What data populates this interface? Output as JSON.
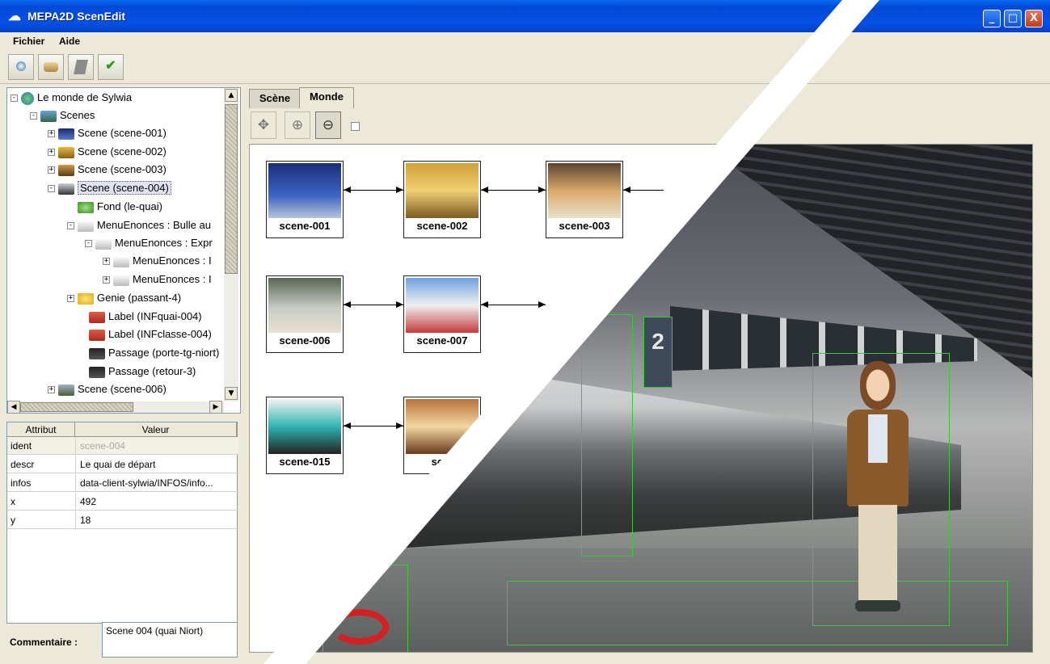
{
  "window": {
    "title": "MEPA2D ScenEdit",
    "minimize": "_",
    "maximize": "□",
    "close": "X"
  },
  "menu": {
    "fichier": "Fichier",
    "aide": "Aide"
  },
  "toolbar": {
    "icons": [
      "new-icon",
      "open-icon",
      "save-icon",
      "validate-icon"
    ]
  },
  "tree": {
    "root": "Le monde de Sylwia",
    "scenes": "Scenes",
    "items": [
      {
        "label": "Scene (scene-001)",
        "toggle": "+"
      },
      {
        "label": "Scene (scene-002)",
        "toggle": "+"
      },
      {
        "label": "Scene (scene-003)",
        "toggle": "+"
      },
      {
        "label": "Scene (scene-004)",
        "toggle": "-"
      },
      {
        "label": "Fond (le-quai)"
      },
      {
        "label": "MenuEnonces : Bulle au",
        "toggle": "-"
      },
      {
        "label": "MenuEnonces : Expr",
        "toggle": "-"
      },
      {
        "label": "MenuEnonces : I",
        "toggle": "+"
      },
      {
        "label": "MenuEnonces : I",
        "toggle": "+"
      },
      {
        "label": "Genie (passant-4)",
        "toggle": "+"
      },
      {
        "label": "Label (INFquai-004)"
      },
      {
        "label": "Label (INFclasse-004)"
      },
      {
        "label": "Passage (porte-tg-niort)"
      },
      {
        "label": "Passage (retour-3)"
      },
      {
        "label": "Scene (scene-006)",
        "toggle": "+"
      }
    ]
  },
  "properties": {
    "header_attr": "Attribut",
    "header_val": "Valeur",
    "rows": [
      {
        "attr": "ident",
        "val": "scene-004"
      },
      {
        "attr": "descr",
        "val": "Le quai de départ"
      },
      {
        "attr": "infos",
        "val": "data-client-sylwia/INFOS/info..."
      },
      {
        "attr": "x",
        "val": "492"
      },
      {
        "attr": "y",
        "val": "18"
      }
    ]
  },
  "comment": {
    "label": "Commentaire :",
    "value": "Scene 004 (quai Niort)"
  },
  "tabs": {
    "scene": "Scène",
    "monde": "Monde"
  },
  "graph": {
    "nodes": [
      "scene-001",
      "scene-002",
      "scene-003",
      "scene-006",
      "scene-007",
      "scene-015",
      "scer"
    ]
  },
  "photo": {
    "sign": "2"
  },
  "colors": {
    "titlebar": "#0550e5",
    "selection": "#dfe4ee",
    "boxes": "#3fc43f"
  }
}
